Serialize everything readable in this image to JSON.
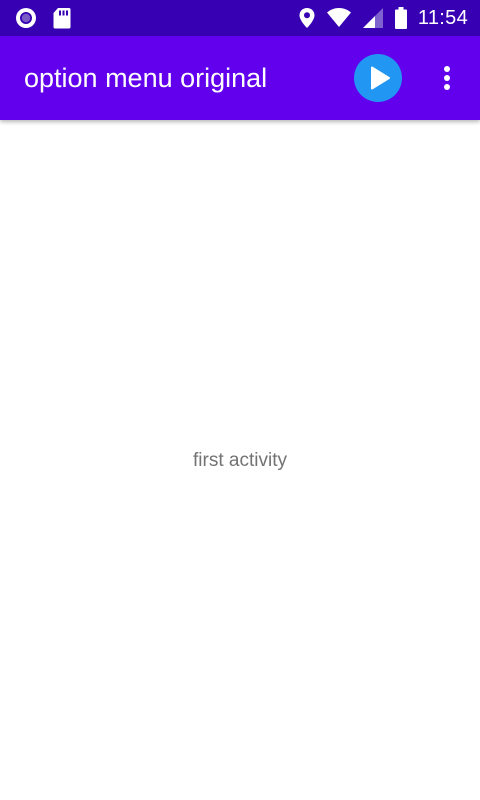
{
  "status_bar": {
    "time": "11:54",
    "icons": [
      "notification-circle-icon",
      "sd-card-icon",
      "location-icon",
      "wifi-icon",
      "signal-icon",
      "battery-icon"
    ]
  },
  "app_bar": {
    "title": "option menu original",
    "actions": [
      "play-icon",
      "more-vert-icon"
    ]
  },
  "main": {
    "text": "first activity"
  },
  "colors": {
    "status_bar": "#3700b3",
    "app_bar": "#6200ee",
    "play_button": "#2196f3",
    "body_text": "#737373",
    "background": "#ffffff"
  }
}
